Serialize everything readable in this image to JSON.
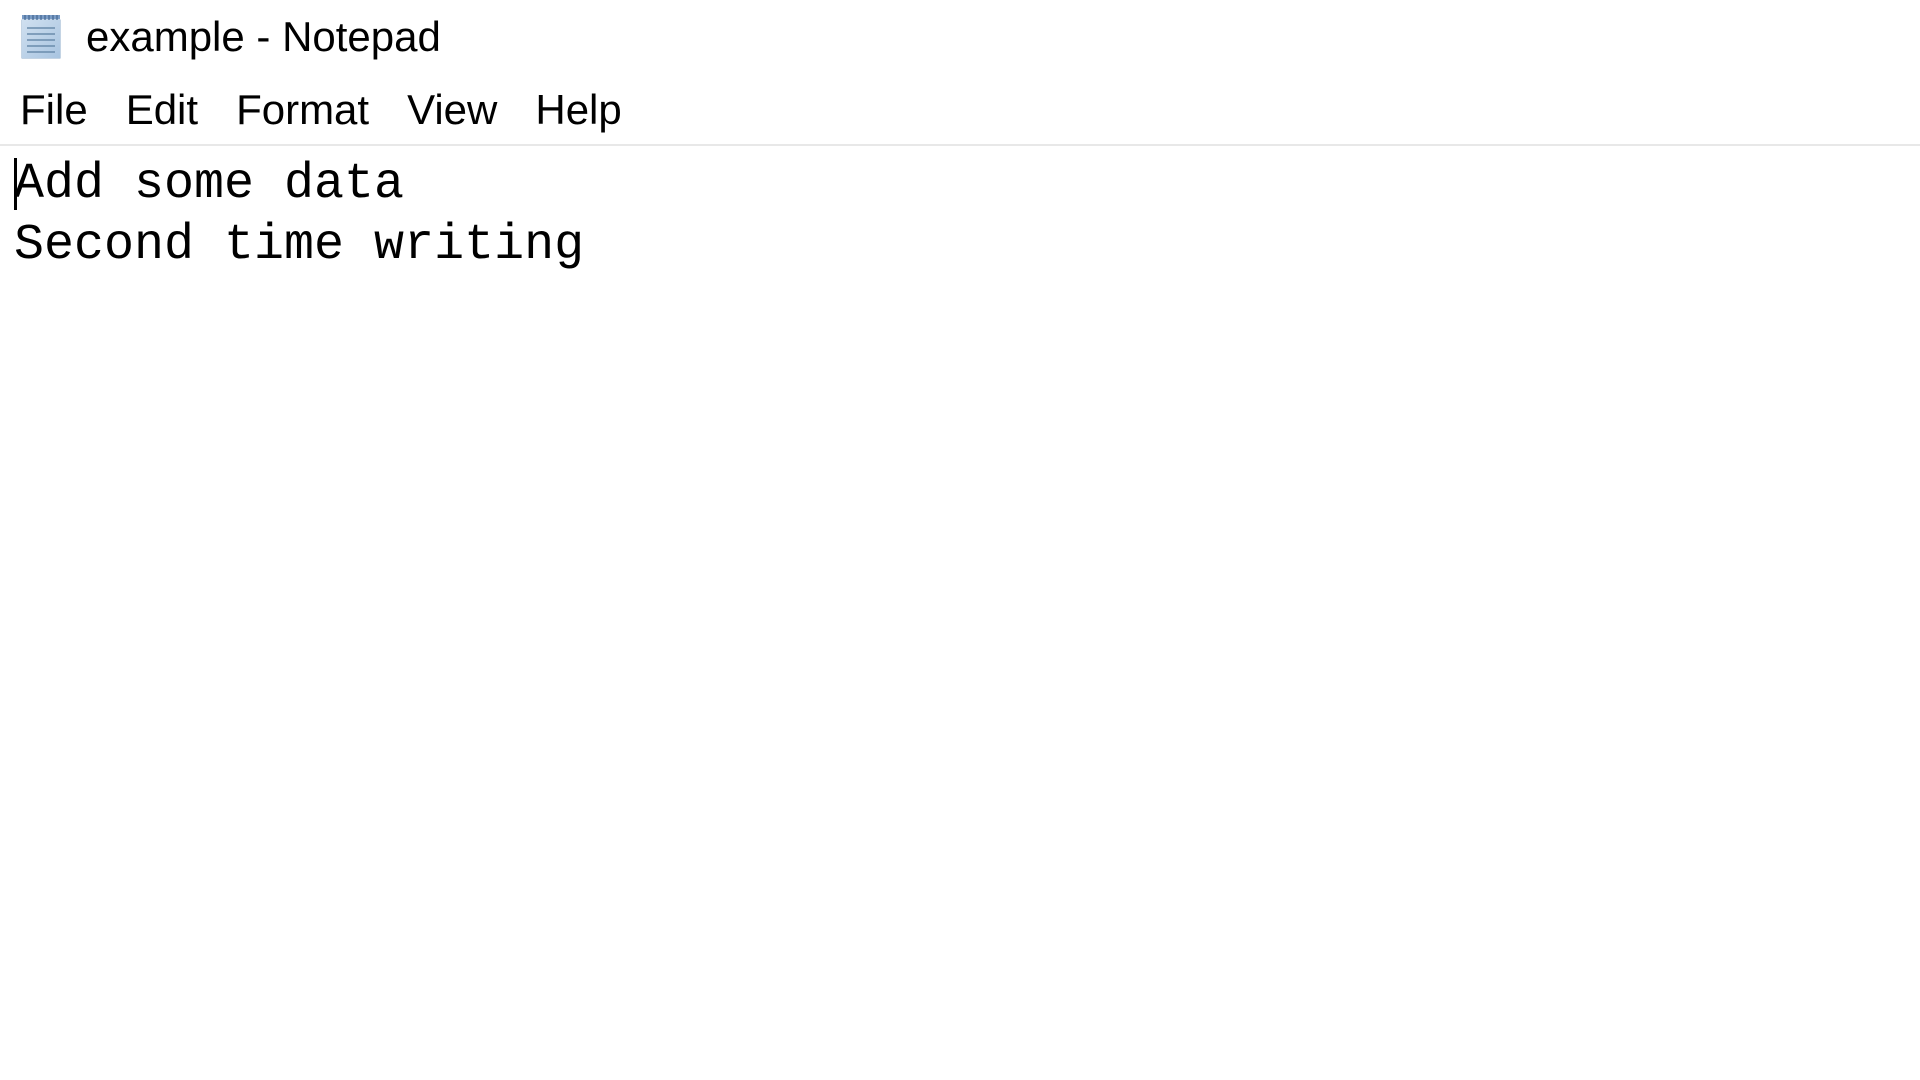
{
  "titlebar": {
    "title": "example - Notepad"
  },
  "menubar": {
    "items": [
      {
        "label": "File"
      },
      {
        "label": "Edit"
      },
      {
        "label": "Format"
      },
      {
        "label": "View"
      },
      {
        "label": "Help"
      }
    ]
  },
  "editor": {
    "content": "Add some data\nSecond time writing"
  }
}
